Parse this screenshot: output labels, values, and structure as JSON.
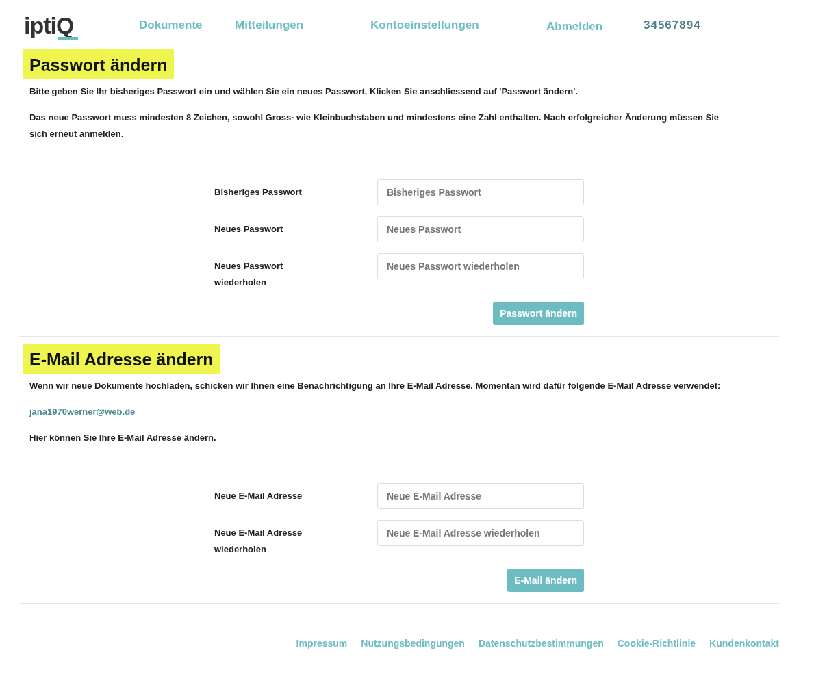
{
  "header": {
    "logo": "iptiQ",
    "nav": [
      {
        "label": "Dokumente"
      },
      {
        "label": "Mitteilungen"
      },
      {
        "label": "Kontoeinstellungen"
      },
      {
        "label": "Abmelden"
      }
    ],
    "account_number": "34567894"
  },
  "sections": [
    {
      "title": "Passwort ändern",
      "paragraphs": [
        {
          "kind": "text",
          "text": "Bitte geben Sie Ihr bisheriges Passwort ein und wählen Sie ein neues Passwort. Klicken Sie anschliessend auf 'Passwort ändern'."
        },
        {
          "kind": "text",
          "text": "Das neue Passwort muss mindesten 8 Zeichen, sowohl Gross- wie Kleinbuchstaben und mindestens eine Zahl enthalten. Nach erfolgreicher Änderung müssen Sie sich erneut anmelden."
        }
      ],
      "fields": [
        {
          "label": "Bisheriges Passwort",
          "placeholder": "Bisheriges Passwort"
        },
        {
          "label": "Neues Passwort",
          "placeholder": "Neues Passwort"
        },
        {
          "label": "Neues Passwort wiederholen",
          "placeholder": "Neues Passwort wiederholen"
        }
      ],
      "button": "Passwort ändern"
    },
    {
      "title": "E-Mail Adresse ändern",
      "paragraphs": [
        {
          "kind": "text",
          "text": "Wenn wir neue Dokumente hochladen, schicken wir Ihnen eine Benachrichtigung an Ihre E-Mail Adresse. Momentan wird dafür folgende E-Mail Adresse verwendet:"
        },
        {
          "kind": "email",
          "text": "jana1970werner@web.de"
        },
        {
          "kind": "text",
          "text": "Hier können Sie Ihre E-Mail Adresse ändern."
        }
      ],
      "fields": [
        {
          "label": "Neue E-Mail Adresse",
          "placeholder": "Neue E-Mail Adresse"
        },
        {
          "label": "Neue E-Mail Adresse wiederholen",
          "placeholder": "Neue E-Mail Adresse wiederholen"
        }
      ],
      "button": "E-Mail ändern"
    }
  ],
  "footer": {
    "links": [
      "Impressum",
      "Nutzungsbedingungen",
      "Datenschutzbestimmungen",
      "Cookie-Richtlinie",
      "Kundenkontakt"
    ]
  }
}
